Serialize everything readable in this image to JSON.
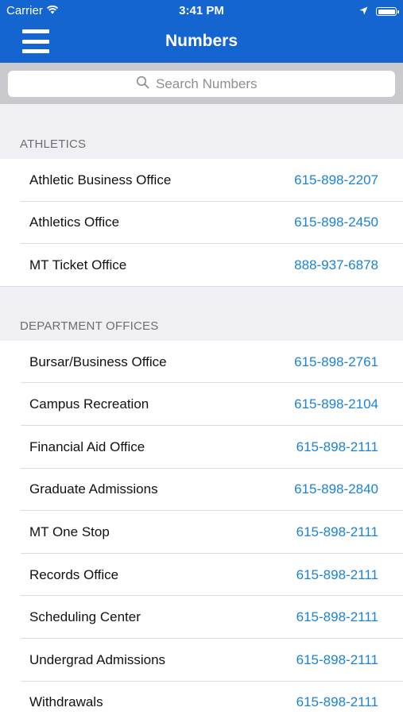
{
  "status_bar": {
    "carrier": "Carrier",
    "time": "3:41 PM",
    "icons": [
      "wifi-icon",
      "location-arrow-icon",
      "battery-icon"
    ]
  },
  "nav": {
    "title": "Numbers",
    "menu_icon": "hamburger-menu-icon"
  },
  "search": {
    "placeholder": "Search Numbers",
    "value": ""
  },
  "colors": {
    "nav_background": "#1565d1",
    "link": "#1b82d8",
    "section_background": "#efeff4"
  },
  "sections": [
    {
      "title": "ATHLETICS",
      "items": [
        {
          "name": "Athletic Business Office",
          "phone": "615-898-2207"
        },
        {
          "name": "Athletics Office",
          "phone": "615-898-2450"
        },
        {
          "name": "MT Ticket Office",
          "phone": "888-937-6878"
        }
      ]
    },
    {
      "title": "DEPARTMENT OFFICES",
      "items": [
        {
          "name": "Bursar/Business Office",
          "phone": "615-898-2761"
        },
        {
          "name": "Campus Recreation",
          "phone": "615-898-2104"
        },
        {
          "name": "Financial Aid Office",
          "phone": "615-898-2111"
        },
        {
          "name": "Graduate Admissions",
          "phone": "615-898-2840"
        },
        {
          "name": "MT One Stop",
          "phone": "615-898-2111"
        },
        {
          "name": "Records Office",
          "phone": "615-898-2111"
        },
        {
          "name": "Scheduling Center",
          "phone": "615-898-2111"
        },
        {
          "name": "Undergrad Admissions",
          "phone": "615-898-2111"
        },
        {
          "name": "Withdrawals",
          "phone": "615-898-2111"
        }
      ]
    }
  ]
}
